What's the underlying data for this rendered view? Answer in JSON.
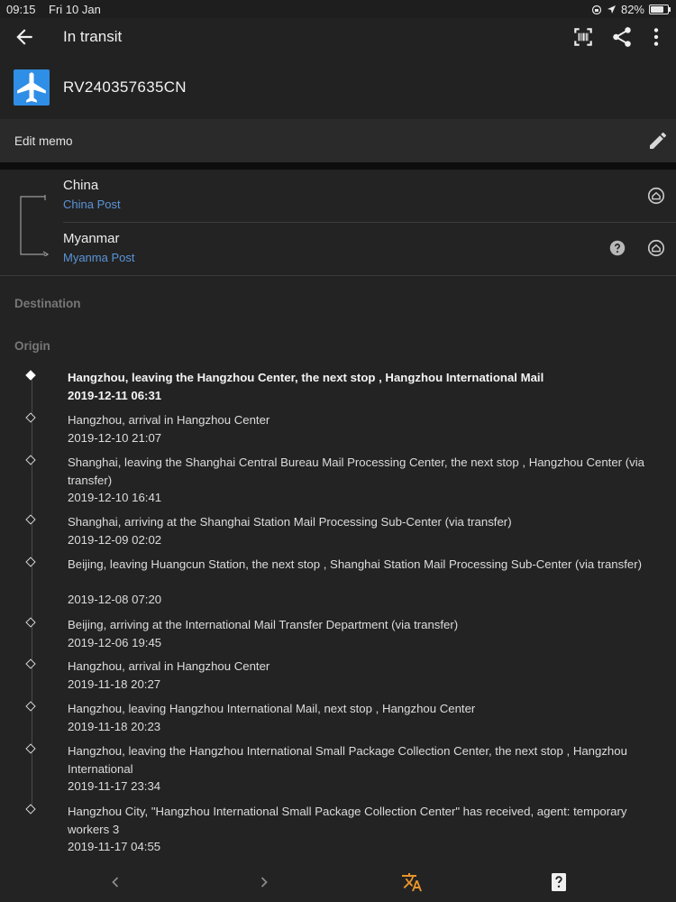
{
  "status": {
    "time": "09:15",
    "date": "Fri 10 Jan",
    "battery": "82%",
    "battery_level": 0.82
  },
  "appbar": {
    "title": "In transit",
    "tracking_number": "RV240357635CN",
    "icons": [
      "back-arrow-icon",
      "barcode-scan-icon",
      "share-icon",
      "more-vert-icon",
      "airplane-icon"
    ]
  },
  "memo": {
    "label": "Edit memo"
  },
  "carriers": [
    {
      "country": "China",
      "carrier": "China Post"
    },
    {
      "country": "Myanmar",
      "carrier": "Myanma Post"
    }
  ],
  "sections": {
    "destination": "Destination",
    "origin": "Origin"
  },
  "events": [
    {
      "desc": "Hangzhou, leaving the Hangzhou Center, the next stop , Hangzhou International Mail",
      "time": "2019-12-11 06:31"
    },
    {
      "desc": "Hangzhou, arrival in Hangzhou Center",
      "time": "2019-12-10 21:07"
    },
    {
      "desc": "Shanghai, leaving the Shanghai Central Bureau Mail Processing Center, the next stop , Hangzhou Center (via transfer)",
      "time": "2019-12-10 16:41"
    },
    {
      "desc": "Shanghai, arriving at the Shanghai Station Mail Processing Sub-Center (via transfer)",
      "time": "2019-12-09 02:02"
    },
    {
      "desc": "Beijing, leaving Huangcun Station, the next stop , Shanghai Station Mail Processing Sub-Center (via transfer)",
      "time": "2019-12-08 07:20"
    },
    {
      "desc": "Beijing, arriving at the International Mail Transfer Department (via transfer)",
      "time": "2019-12-06 19:45"
    },
    {
      "desc": "Hangzhou, arrival in Hangzhou Center",
      "time": "2019-11-18 20:27"
    },
    {
      "desc": "Hangzhou, leaving Hangzhou International Mail, next stop , Hangzhou Center",
      "time": "2019-11-18 20:23"
    },
    {
      "desc": "Hangzhou, leaving the Hangzhou International Small Package Collection Center, the next stop , Hangzhou International",
      "time": "2019-11-17 23:34"
    },
    {
      "desc": "Hangzhou City, \"Hangzhou International Small Package Collection Center\" has received, agent: temporary workers 3",
      "time": "2019-11-17 04:55"
    }
  ],
  "colors": {
    "accent_blue": "#2f8ee6",
    "link_blue": "#5b94d9",
    "translate_orange": "#e8942c"
  }
}
